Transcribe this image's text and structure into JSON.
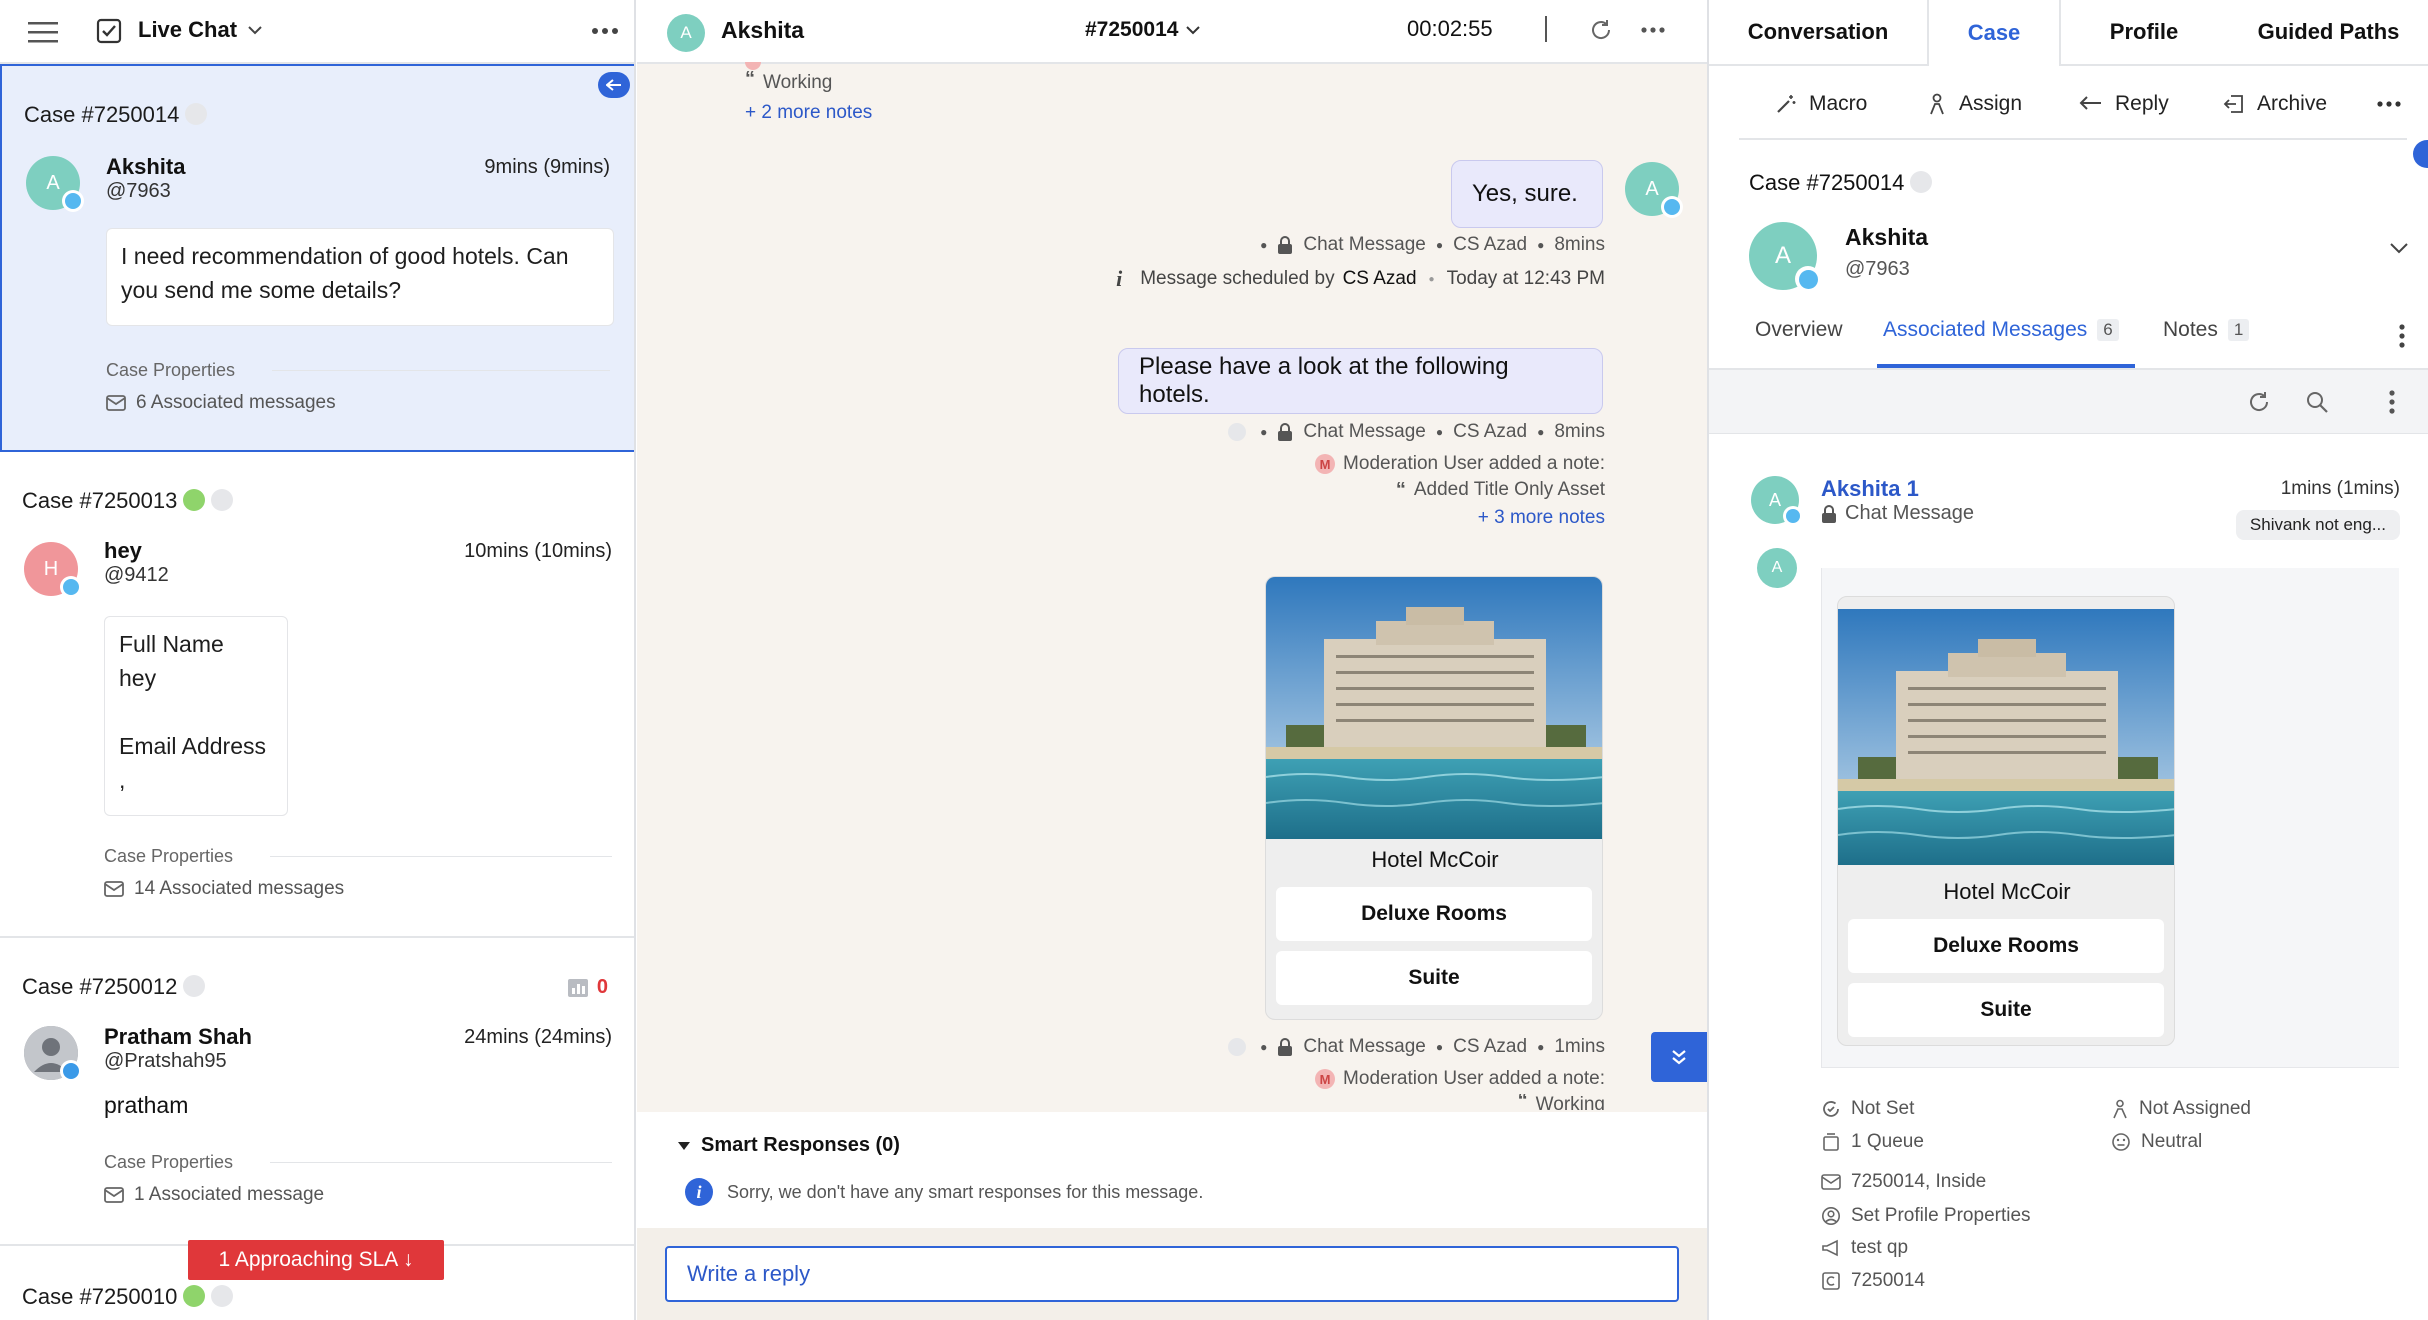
{
  "left": {
    "title": "Live Chat",
    "sla_banner": "1 Approaching SLA ↓",
    "cases": [
      {
        "id": "Case #7250014",
        "name": "Akshita",
        "handle": "@7963",
        "time": "9mins (9mins)",
        "avatar": "A",
        "avatar_color": "#7ecfc0",
        "message": [
          "I need recommendation of good hotels. Can",
          "you send me some details?"
        ],
        "props_label": "Case Properties",
        "assoc": "6 Associated messages"
      },
      {
        "id": "Case #7250013",
        "name": "hey",
        "handle": "@9412",
        "time": "10mins (10mins)",
        "avatar": "H",
        "avatar_color": "#f0969a",
        "message": [
          "Full Name",
          "hey",
          "",
          "Email Address",
          ","
        ],
        "props_label": "Case Properties",
        "assoc": "14 Associated messages"
      },
      {
        "id": "Case #7250012",
        "name": "Pratham Shah",
        "handle": "@Pratshah95",
        "time": "24mins (24mins)",
        "message": [
          "pratham"
        ],
        "props_label": "Case Properties",
        "assoc": "1 Associated message",
        "count": "0"
      },
      {
        "id": "Case #7250010"
      }
    ]
  },
  "middle": {
    "contact_avatar": "A",
    "contact_name": "Akshita",
    "case_number": "#7250014",
    "timer": "00:02:55",
    "top_note": "Working",
    "top_more_notes": "+ 2 more notes",
    "msg1": {
      "text": "Yes, sure.",
      "meta": [
        "Chat Message",
        "CS Azad",
        "8mins"
      ],
      "scheduled_prefix": "Message scheduled by",
      "scheduled_by": "CS Azad",
      "scheduled_time": "Today at 12:43 PM"
    },
    "msg2": {
      "text": "Please have a look at the following hotels.",
      "meta": [
        "Chat Message",
        "CS Azad",
        "8mins"
      ],
      "note_author": "Moderation User added a note:",
      "note_text": "Added Title Only Asset",
      "more_notes": "+ 3 more notes"
    },
    "card": {
      "title": "Hotel McCoir",
      "buttons": [
        "Deluxe Rooms",
        "Suite"
      ],
      "meta": [
        "Chat Message",
        "CS Azad",
        "1mins"
      ],
      "note_author": "Moderation User added a note:",
      "note_text": "Working"
    },
    "smart_title": "Smart Responses (0)",
    "smart_empty": "Sorry, we don't have any smart responses for this message.",
    "reply_placeholder": "Write a reply"
  },
  "right": {
    "tabs": [
      "Conversation",
      "Case",
      "Profile",
      "Guided Paths"
    ],
    "active_tab": "Case",
    "actions": [
      "Macro",
      "Assign",
      "Reply",
      "Archive"
    ],
    "case_id": "Case #7250014",
    "name": "Akshita",
    "handle": "@7963",
    "avatar": "A",
    "subtabs": [
      {
        "label": "Overview",
        "count": ""
      },
      {
        "label": "Associated Messages",
        "count": "6"
      },
      {
        "label": "Notes",
        "count": "1"
      }
    ],
    "msg": {
      "sender": "Akshita 1",
      "type": "Chat Message",
      "time": "1mins (1mins)",
      "tag": "Shivank not eng...",
      "card_title": "Hotel McCoir",
      "buttons": [
        "Deluxe Rooms",
        "Suite"
      ]
    },
    "props": {
      "status": "Not Set",
      "assignee": "Not Assigned",
      "queue": "1 Queue",
      "sentiment": "Neutral",
      "case_ref": "7250014, Inside",
      "profile": "Set Profile Properties",
      "channel": "test qp",
      "number": "7250014"
    }
  },
  "colors": {
    "accent": "#2f64d8",
    "sla_red": "#e0373a",
    "teal_avatar": "#7ecfc0",
    "link": "#2c58c8"
  }
}
